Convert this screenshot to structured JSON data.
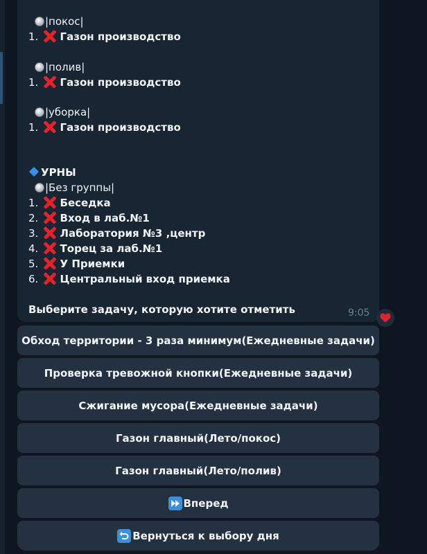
{
  "message": {
    "groups_top": [
      {
        "tag": "|покос|",
        "items": [
          {
            "num": "1.",
            "label": "Газон производство"
          }
        ]
      },
      {
        "tag": "|полив|",
        "items": [
          {
            "num": "1.",
            "label": "Газон производство"
          }
        ]
      },
      {
        "tag": "|уборка|",
        "items": [
          {
            "num": "1.",
            "label": "Газон производство"
          }
        ]
      }
    ],
    "section_title": "УРНЫ",
    "section_tag": "|Без группы|",
    "section_items": [
      {
        "num": "1.",
        "label": "Беседка"
      },
      {
        "num": "2.",
        "label": "Вход в лаб.№1"
      },
      {
        "num": "3.",
        "label": "Лаборатория №3 ,центр"
      },
      {
        "num": "4.",
        "label": "Торец за лаб.№1"
      },
      {
        "num": "5.",
        "label": "У Приемки"
      },
      {
        "num": "6.",
        "label": "Центральный вход приемка"
      }
    ],
    "prompt": "Выберите задачу, которую хотите отметить",
    "time": "9:05",
    "reaction_icon": "heart-icon",
    "status_icon": "cross-mark-icon",
    "item_icon": "radio-icon",
    "section_icon": "blue-diamond-icon"
  },
  "keyboard": {
    "buttons": [
      {
        "label": "Обход территории - 3 раза минимум(Ежедневные задачи)"
      },
      {
        "label": "Проверка тревожной кнопки(Ежедневные задачи)"
      },
      {
        "label": "Сжигание мусора(Ежедневные задачи)"
      },
      {
        "label": "Газон главный(Лето/покос)"
      },
      {
        "label": "Газон главный(Лето/полив)"
      },
      {
        "label": "Вперед",
        "icon": "fast-forward-icon"
      },
      {
        "label": " Вернуться к выбору дня",
        "icon": "return-arrow-icon"
      }
    ]
  },
  "colors": {
    "background": "#0e1621",
    "bubble": "#182533",
    "button": "#243140",
    "cross": "#e8202a",
    "accent": "#3a8ee6"
  }
}
